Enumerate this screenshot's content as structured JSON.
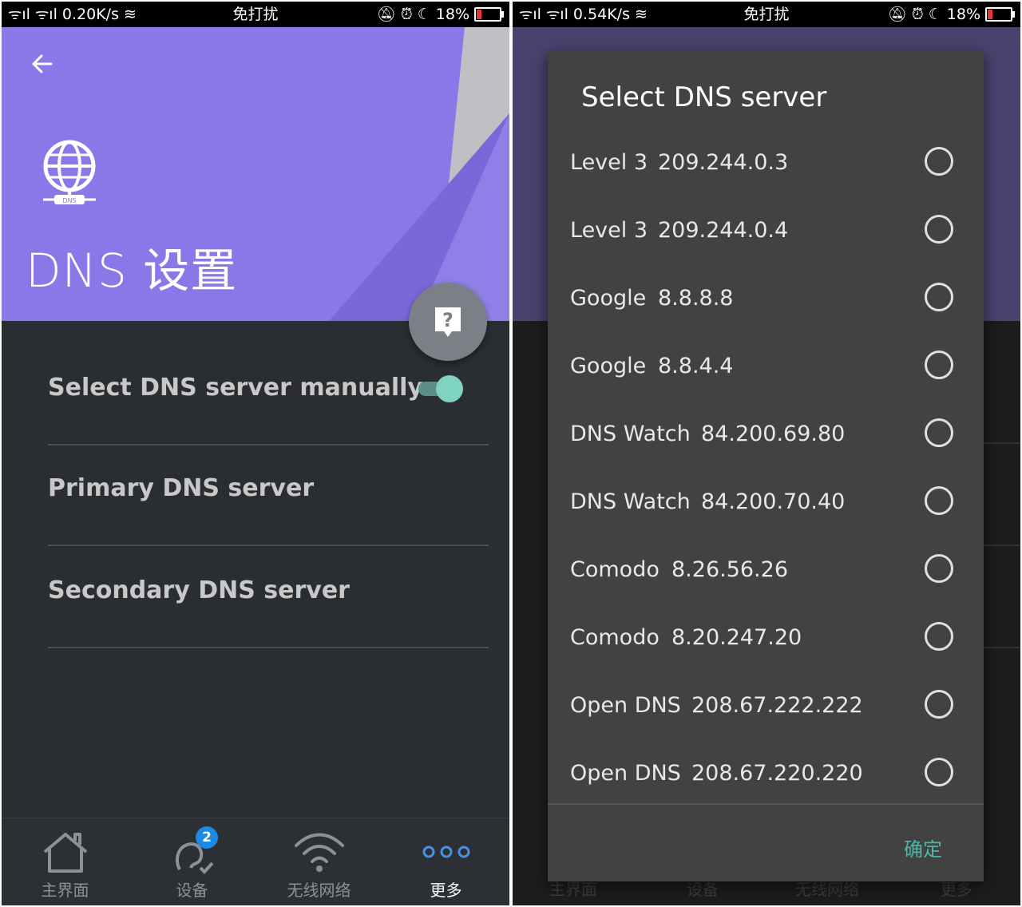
{
  "left": {
    "status_bar": {
      "signal": "ᯤıl ᯤıl",
      "speed": "0.20K/s",
      "mode": "免打扰",
      "battery": "18%"
    },
    "title": "DNS 设置",
    "globe_label": "DNS",
    "settings": [
      {
        "label": "Select DNS server manually"
      },
      {
        "label": "Primary DNS server"
      },
      {
        "label": "Secondary DNS server"
      }
    ],
    "nav": [
      {
        "label": "主界面",
        "icon": "home-icon"
      },
      {
        "label": "设备",
        "icon": "devices-icon",
        "badge": "2"
      },
      {
        "label": "无线网络",
        "icon": "wifi-icon"
      },
      {
        "label": "更多",
        "icon": "more-icon"
      }
    ]
  },
  "right": {
    "status_bar": {
      "signal": "ᯤıl ᯤıl",
      "speed": "0.54K/s",
      "mode": "免打扰",
      "battery": "18%"
    },
    "dialog": {
      "title": "Select DNS server",
      "options": [
        {
          "name": "Level 3",
          "ip": "209.244.0.3"
        },
        {
          "name": "Level 3",
          "ip": "209.244.0.4"
        },
        {
          "name": "Google",
          "ip": "8.8.8.8"
        },
        {
          "name": "Google",
          "ip": "8.8.4.4"
        },
        {
          "name": "DNS Watch",
          "ip": "84.200.69.80"
        },
        {
          "name": "DNS Watch",
          "ip": "84.200.70.40"
        },
        {
          "name": "Comodo",
          "ip": "8.26.56.26"
        },
        {
          "name": "Comodo",
          "ip": "8.20.247.20"
        },
        {
          "name": "Open DNS",
          "ip": "208.67.222.222"
        },
        {
          "name": "Open DNS",
          "ip": "208.67.220.220"
        }
      ],
      "confirm": "确定"
    },
    "nav": [
      "主界面",
      "设备",
      "无线网络",
      "更多"
    ]
  },
  "colors": {
    "header": "#8a78e8",
    "accent": "#7fd3c3",
    "confirm": "#4db6ac",
    "badge": "#1e88e5"
  }
}
